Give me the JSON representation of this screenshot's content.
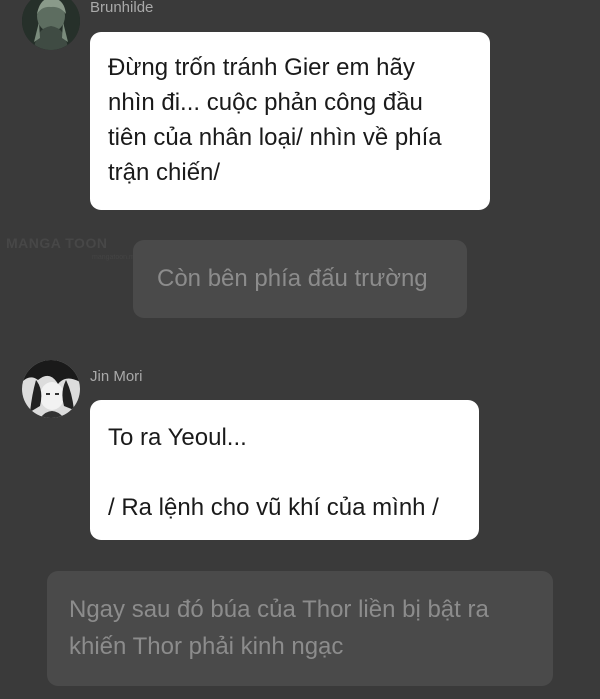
{
  "watermark": {
    "brand": "MANGA TOON",
    "tagline": "mangatoon.mobi"
  },
  "messages": [
    {
      "type": "incoming",
      "sender": "Brunhilde",
      "avatar": "brunhilde-avatar",
      "lines": [
        "Đừng trốn tránh Gier em hãy",
        "nhìn đi... cuộc phản công đầu",
        "tiên của nhân loại/ nhìn về phía",
        "trận chiến/"
      ]
    },
    {
      "type": "narration",
      "lines": [
        "Còn bên phía đấu trường"
      ]
    },
    {
      "type": "incoming",
      "sender": "Jin Mori",
      "avatar": "jin-mori-avatar",
      "lines": [
        "To ra Yeoul...",
        "",
        "/ Ra lệnh cho vũ khí của mình /"
      ]
    },
    {
      "type": "narration",
      "lines": [
        "Ngay sau đó búa của Thor liền bị bật ra",
        "khiến Thor phải kinh ngạc"
      ]
    }
  ],
  "colors": {
    "background": "#3a3a3a",
    "bubble_white": "#ffffff",
    "bubble_dark": "#4a4a4a",
    "text_dark": "#1a1a1a",
    "text_muted": "#8c8c8c",
    "name_text": "#a9a9a9"
  }
}
